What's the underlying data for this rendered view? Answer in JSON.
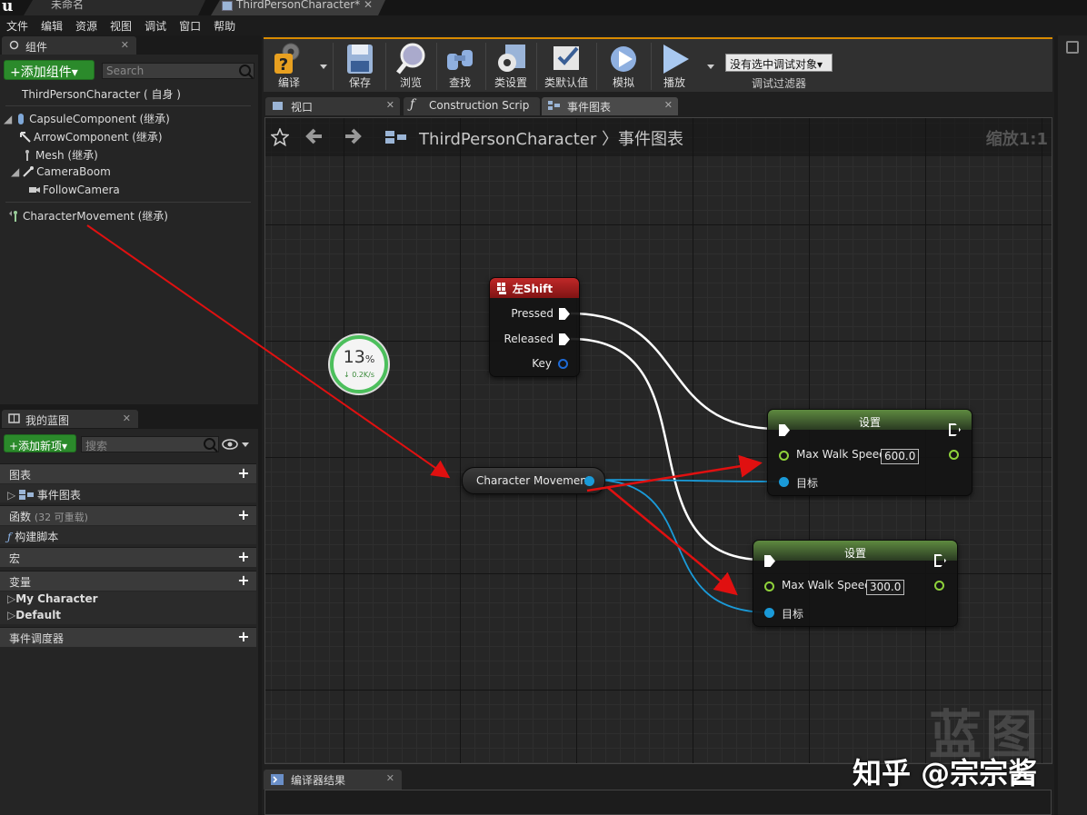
{
  "titlebar": {
    "tabs": [
      {
        "label": "未命名"
      },
      {
        "label": "ThirdPersonCharacter*"
      }
    ],
    "close_glyph": "✕"
  },
  "menu": [
    "文件",
    "编辑",
    "资源",
    "视图",
    "调试",
    "窗口",
    "帮助"
  ],
  "components_panel": {
    "tab_label": "组件",
    "add_button": "+添加组件▾",
    "search_placeholder": "Search",
    "self_item": "ThirdPersonCharacter ( 自身 )",
    "tree": [
      {
        "label": "CapsuleComponent (继承)"
      },
      {
        "label": "ArrowComponent (继承)"
      },
      {
        "label": "Mesh (继承)"
      },
      {
        "label": "CameraBoom"
      },
      {
        "label": "FollowCamera"
      },
      {
        "label": "CharacterMovement (继承)"
      }
    ]
  },
  "myblueprint_panel": {
    "tab_label": "我的蓝图",
    "add_button": "+添加新项▾",
    "search_placeholder": "搜索",
    "sections": {
      "graphs": {
        "label": "图表",
        "item": "事件图表"
      },
      "functions": {
        "label": "函数",
        "muted": "(32 可重载)",
        "item": "构建脚本"
      },
      "macros": {
        "label": "宏"
      },
      "variables": {
        "label": "变量",
        "items": [
          "My Character",
          "Default"
        ]
      },
      "dispatchers": {
        "label": "事件调度器"
      }
    }
  },
  "toolbar": {
    "compile": "编译",
    "save": "保存",
    "browse": "浏览",
    "find": "查找",
    "class_settings": "类设置",
    "class_defaults": "类默认值",
    "simulate": "模拟",
    "play": "播放",
    "debug_select": "没有选中调试对象▾",
    "debug_filter": "调试过滤器"
  },
  "graph_tabs": [
    {
      "label": "视口"
    },
    {
      "label": "Construction Scrip"
    },
    {
      "label": "事件图表"
    }
  ],
  "graph": {
    "breadcrumb": "ThirdPersonCharacter 〉事件图表",
    "zoom": "缩放1:1",
    "watermark": "蓝图"
  },
  "nodes": {
    "key_node": {
      "title": "左Shift",
      "pins": [
        "Pressed",
        "Released",
        "Key"
      ]
    },
    "var_node": {
      "label": "Character Movement"
    },
    "set_node_1": {
      "title": "设置",
      "field_label": "Max Walk Speed",
      "value": "600.0",
      "target": "目标"
    },
    "set_node_2": {
      "title": "设置",
      "field_label": "Max Walk Speed",
      "value": "300.0",
      "target": "目标"
    }
  },
  "speed_badge": {
    "percent": "13",
    "percent_sign": "%",
    "rate": "↓ 0.2K/s"
  },
  "bottom_panel": {
    "tab_label": "编译器结果"
  },
  "overlay_watermark": "知乎 @宗宗酱",
  "colors": {
    "exec_wire": "#ffffff",
    "object_wire": "#1a9ad8",
    "float_pin": "#8fd23b",
    "annotation_arrow": "#e01010",
    "key_node_title": "#a01818",
    "set_node_title": "#4a6a35"
  }
}
